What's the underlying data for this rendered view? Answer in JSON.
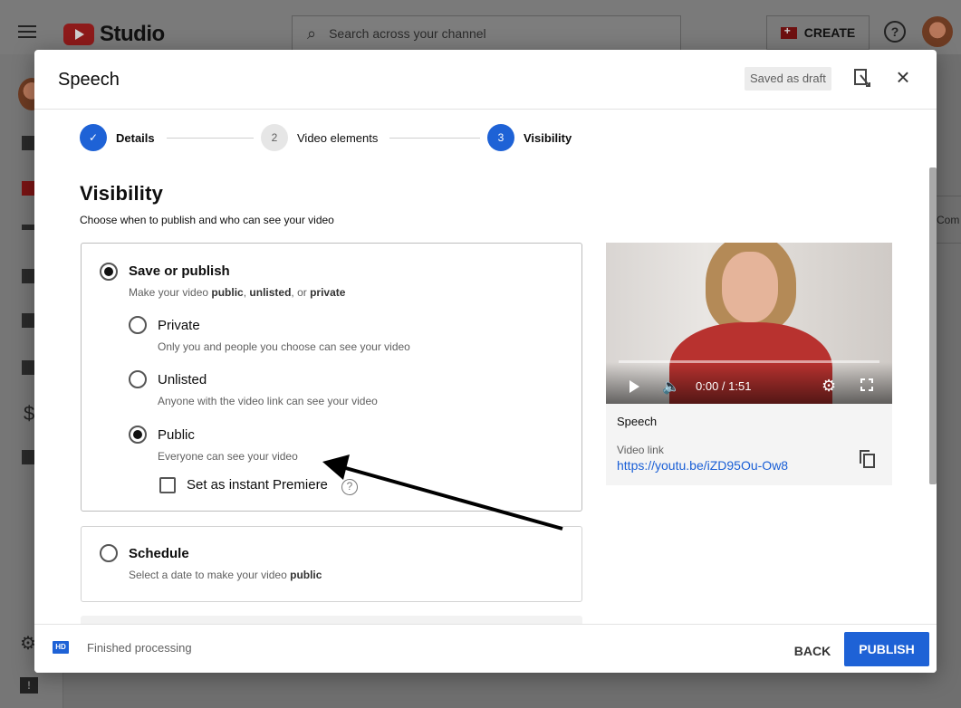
{
  "app": {
    "logo_text": "Studio",
    "search_placeholder": "Search across your channel",
    "create_label": "CREATE",
    "help_label": "?",
    "right_fragment": "Com"
  },
  "dialog": {
    "title": "Speech",
    "draft_badge": "Saved as draft",
    "close_glyph": "×"
  },
  "stepper": {
    "steps": [
      {
        "number": "✓",
        "label": "Details",
        "state": "done"
      },
      {
        "number": "2",
        "label": "Video elements",
        "state": "todo"
      },
      {
        "number": "3",
        "label": "Visibility",
        "state": "active"
      }
    ]
  },
  "visibility": {
    "title": "Visibility",
    "subtitle": "Choose when to publish and who can see your video",
    "save_publish": {
      "label": "Save or publish",
      "desc_prefix": "Make your video ",
      "desc_public": "public",
      "desc_sep1": ", ",
      "desc_unlisted": "unlisted",
      "desc_sep2": ", or ",
      "desc_private": "private",
      "selected": true
    },
    "options": [
      {
        "label": "Private",
        "desc": "Only you and people you choose can see your video",
        "selected": false
      },
      {
        "label": "Unlisted",
        "desc": "Anyone with the video link can see your video",
        "selected": false
      },
      {
        "label": "Public",
        "desc": "Everyone can see your video",
        "selected": true
      }
    ],
    "premiere_label": "Set as instant Premiere",
    "premiere_checked": false,
    "schedule": {
      "label": "Schedule",
      "desc_prefix": "Select a date to make your video ",
      "desc_bold": "public",
      "selected": false
    }
  },
  "video": {
    "time": "0:00 / 1:51",
    "title": "Speech",
    "link_label": "Video link",
    "link_url": "https://youtu.be/iZD95Ou-Ow8"
  },
  "footer": {
    "hd_badge": "HD",
    "status": "Finished processing",
    "back_label": "BACK",
    "publish_label": "PUBLISH"
  },
  "colors": {
    "accent": "#1e62d6",
    "brand_red": "#ff0000",
    "link": "#1a5fd6"
  }
}
